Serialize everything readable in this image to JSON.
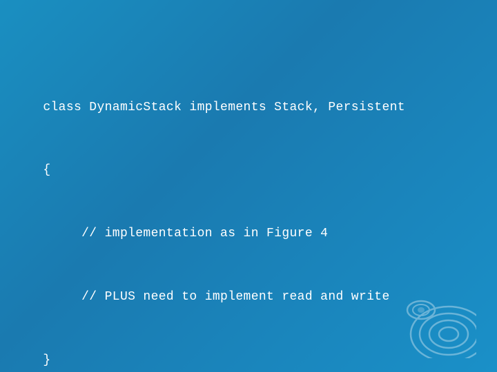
{
  "background": {
    "color": "#1a8fc1"
  },
  "code": {
    "line1": "class DynamicStack implements Stack, Persistent",
    "line2": "{",
    "line3": "     // implementation as in Figure 4",
    "line4": "     // PLUS need to implement read and write",
    "line5": "}"
  }
}
